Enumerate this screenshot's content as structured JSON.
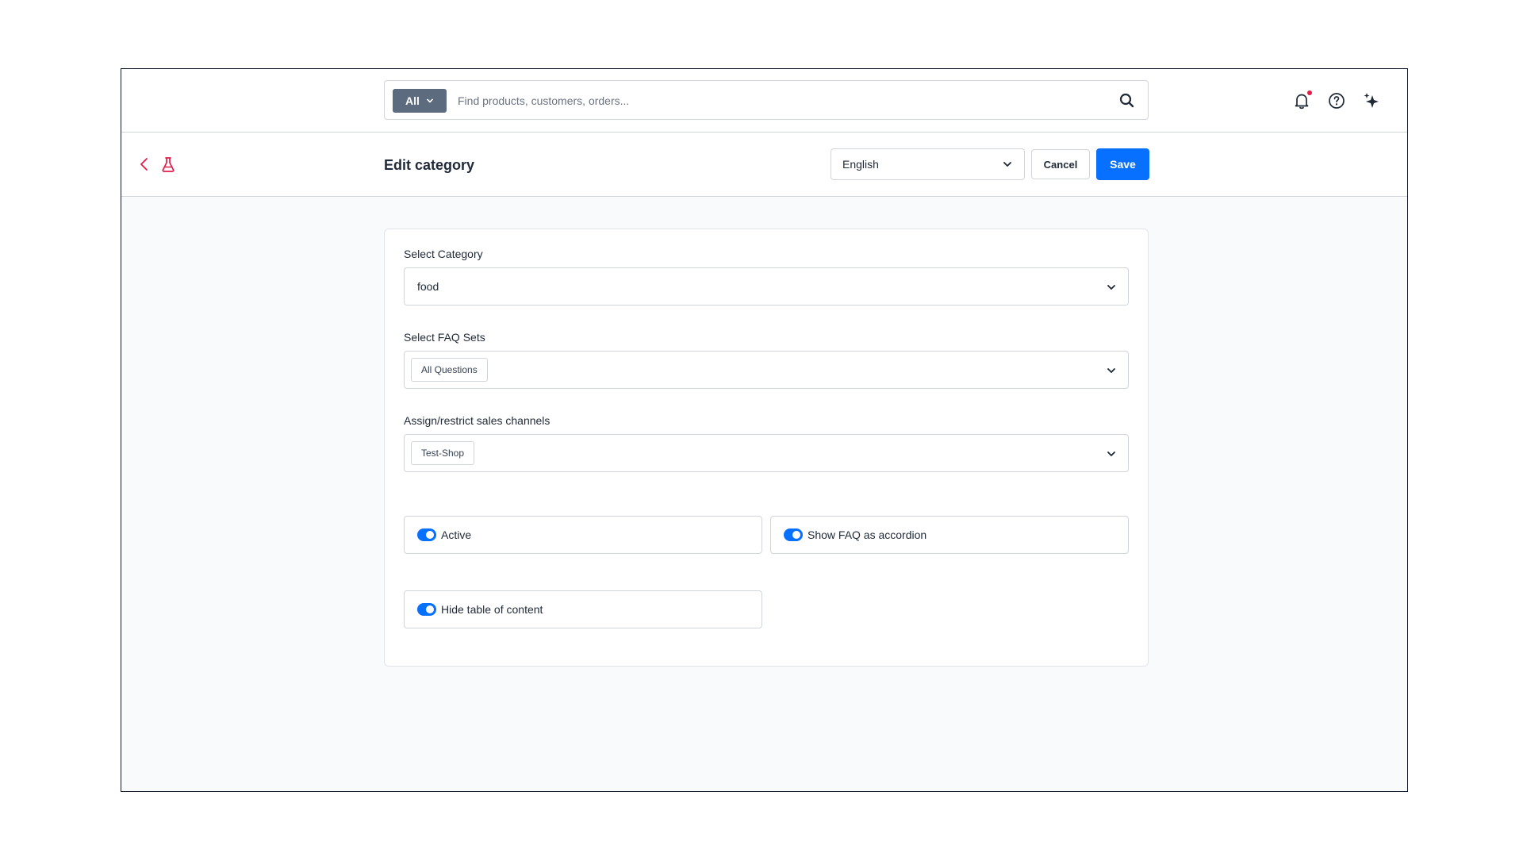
{
  "search": {
    "scope_label": "All",
    "placeholder": "Find products, customers, orders...",
    "value": ""
  },
  "topbar": {
    "icons": [
      "bell-icon",
      "help-icon",
      "sparkle-icon"
    ],
    "notification_dot_color": "#e11d48"
  },
  "header": {
    "title": "Edit category",
    "language": "English",
    "cancel_label": "Cancel",
    "save_label": "Save"
  },
  "form": {
    "category": {
      "label": "Select Category",
      "value": "food"
    },
    "faq_sets": {
      "label": "Select FAQ Sets",
      "tags": [
        "All Questions"
      ]
    },
    "sales_channels": {
      "label": "Assign/restrict sales channels",
      "tags": [
        "Test-Shop"
      ]
    },
    "toggles": [
      {
        "label": "Active",
        "on": true
      },
      {
        "label": "Show FAQ as accordion",
        "on": true
      },
      {
        "label": "Hide table of content",
        "on": true
      }
    ]
  },
  "colors": {
    "primary": "#0870ff",
    "back_accent": "#e11d48",
    "scope_bg": "#5c6b7e"
  }
}
